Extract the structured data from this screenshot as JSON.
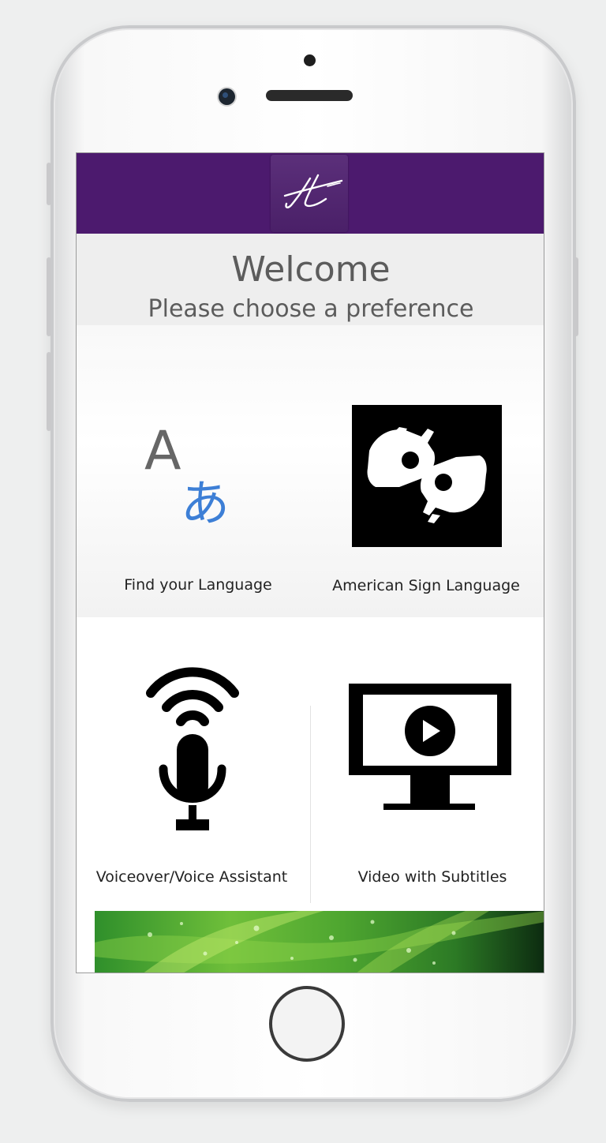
{
  "app": {
    "header": {
      "logo_icon": "script-t-logo-icon",
      "bar_color": "#4c1a6e"
    },
    "welcome": {
      "title": "Welcome",
      "subtitle": "Please choose a preference"
    },
    "options": [
      {
        "label": "Find your Language",
        "icon": "translate-icon"
      },
      {
        "label": "American Sign Language",
        "icon": "sign-language-icon"
      },
      {
        "label": "Voiceover/Voice Assistant",
        "icon": "voice-assistant-microphone-icon"
      },
      {
        "label": "Video with Subtitles",
        "icon": "video-play-monitor-icon"
      }
    ],
    "translate_glyphs": {
      "latin": "A",
      "japanese": "あ"
    },
    "banner": {
      "icon": "green-leaf-waterdrops-image"
    }
  }
}
